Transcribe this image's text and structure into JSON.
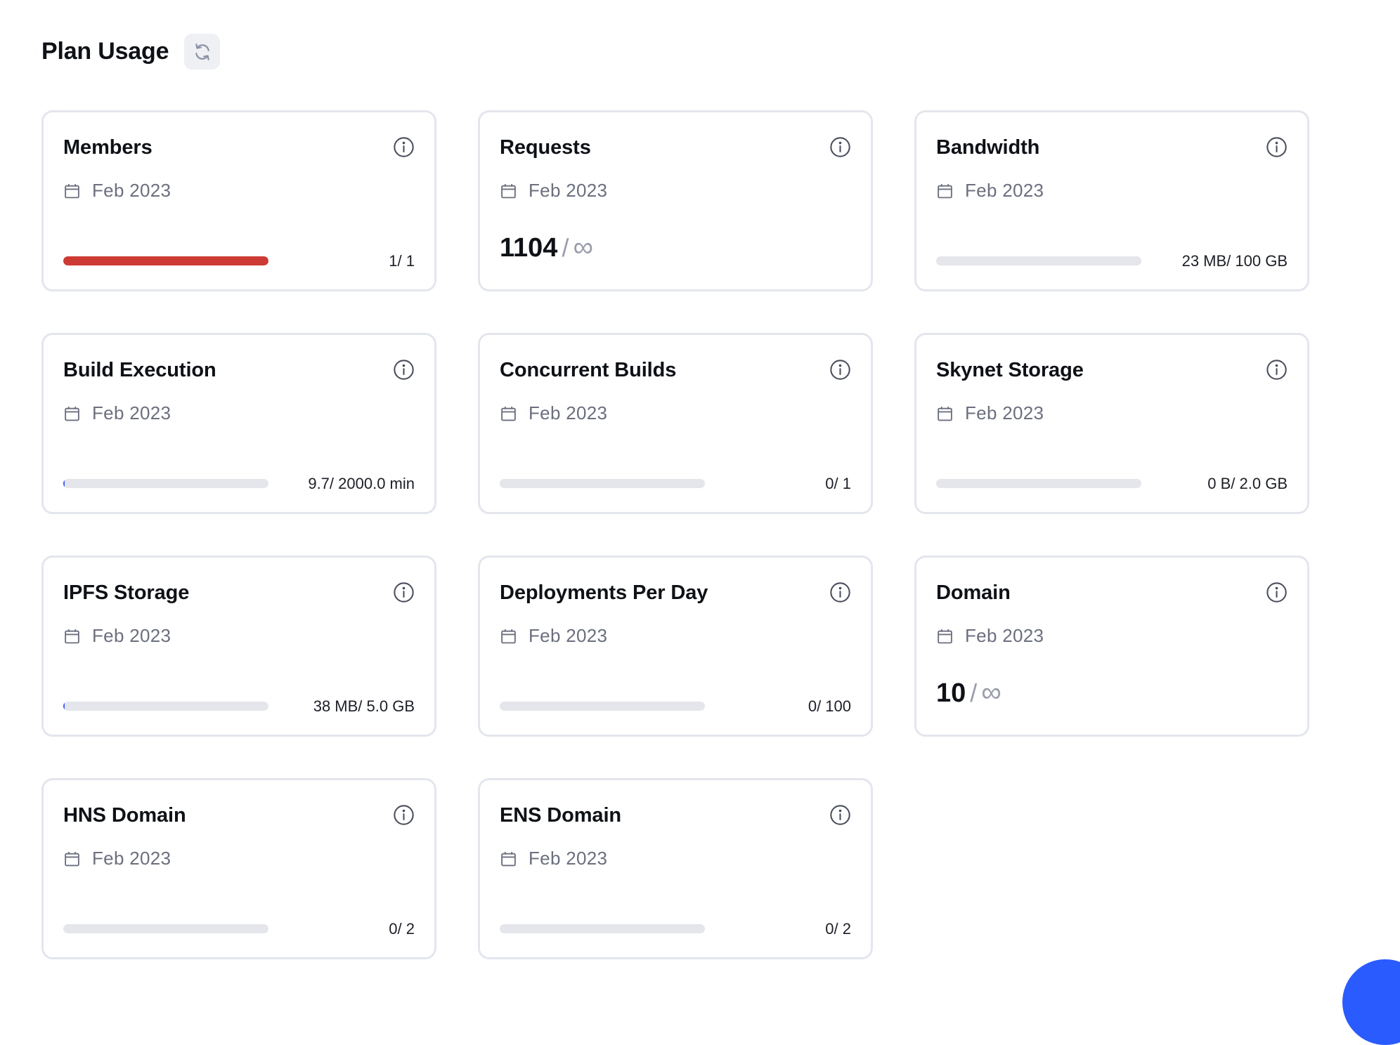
{
  "header": {
    "title": "Plan Usage",
    "refresh_icon": "refresh-icon"
  },
  "colors": {
    "danger_fill": "#cd3a33",
    "accent_fill": "#3b5bfd",
    "track": "#e5e6eb",
    "chat_button": "#2a5bff"
  },
  "cards": [
    {
      "title": "Members",
      "date": "Feb 2023",
      "type": "progress",
      "usage": "1/ 1",
      "progress": 1.0,
      "fill": "danger"
    },
    {
      "title": "Requests",
      "date": "Feb 2023",
      "type": "unlimited",
      "value": "1104",
      "sep": "/",
      "limit": "∞"
    },
    {
      "title": "Bandwidth",
      "date": "Feb 2023",
      "type": "progress",
      "usage": "23 MB/ 100 GB",
      "progress": 0.0,
      "fill": "accent"
    },
    {
      "title": "Build Execution",
      "date": "Feb 2023",
      "type": "progress",
      "usage": "9.7/ 2000.0 min",
      "progress": 0.005,
      "fill": "accent"
    },
    {
      "title": "Concurrent Builds",
      "date": "Feb 2023",
      "type": "progress",
      "usage": "0/ 1",
      "progress": 0.0,
      "fill": "accent"
    },
    {
      "title": "Skynet Storage",
      "date": "Feb 2023",
      "type": "progress",
      "usage": "0 B/ 2.0 GB",
      "progress": 0.0,
      "fill": "accent"
    },
    {
      "title": "IPFS Storage",
      "date": "Feb 2023",
      "type": "progress",
      "usage": "38 MB/ 5.0 GB",
      "progress": 0.007,
      "fill": "accent"
    },
    {
      "title": "Deployments Per Day",
      "date": "Feb 2023",
      "type": "progress",
      "usage": "0/ 100",
      "progress": 0.0,
      "fill": "accent"
    },
    {
      "title": "Domain",
      "date": "Feb 2023",
      "type": "unlimited",
      "value": "10",
      "sep": "/",
      "limit": "∞"
    },
    {
      "title": "HNS Domain",
      "date": "Feb 2023",
      "type": "progress",
      "usage": "0/ 2",
      "progress": 0.0,
      "fill": "accent"
    },
    {
      "title": "ENS Domain",
      "date": "Feb 2023",
      "type": "progress",
      "usage": "0/ 2",
      "progress": 0.0,
      "fill": "accent"
    }
  ]
}
